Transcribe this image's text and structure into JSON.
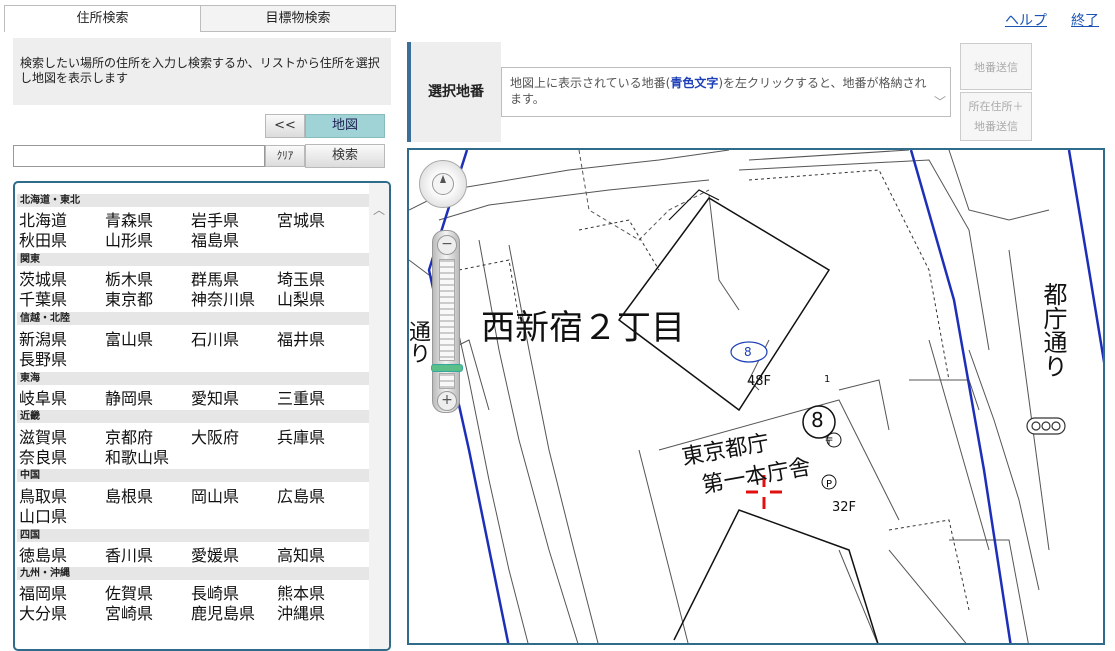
{
  "tabs": {
    "address": "住所検索",
    "landmark": "目標物検索"
  },
  "instruction": "検索したい場所の住所を入力し検索するか、リストから住所を選択し地図を表示します",
  "buttons": {
    "back": "<<",
    "map": "地図",
    "clear": "ｸﾘｱ",
    "search": "検索"
  },
  "search_input": {
    "value": "",
    "placeholder": ""
  },
  "regions": [
    {
      "name": "北海道・東北",
      "prefs": [
        "北海道",
        "青森県",
        "岩手県",
        "宮城県",
        "秋田県",
        "山形県",
        "福島県"
      ]
    },
    {
      "name": "関東",
      "prefs": [
        "茨城県",
        "栃木県",
        "群馬県",
        "埼玉県",
        "千葉県",
        "東京都",
        "神奈川県",
        "山梨県"
      ]
    },
    {
      "name": "信越・北陸",
      "prefs": [
        "新潟県",
        "富山県",
        "石川県",
        "福井県",
        "長野県"
      ]
    },
    {
      "name": "東海",
      "prefs": [
        "岐阜県",
        "静岡県",
        "愛知県",
        "三重県"
      ]
    },
    {
      "name": "近畿",
      "prefs": [
        "滋賀県",
        "京都府",
        "大阪府",
        "兵庫県",
        "奈良県",
        "和歌山県"
      ]
    },
    {
      "name": "中国",
      "prefs": [
        "鳥取県",
        "島根県",
        "岡山県",
        "広島県",
        "山口県"
      ]
    },
    {
      "name": "四国",
      "prefs": [
        "徳島県",
        "香川県",
        "愛媛県",
        "高知県"
      ]
    },
    {
      "name": "九州・沖縄",
      "prefs": [
        "福岡県",
        "佐賀県",
        "長崎県",
        "熊本県",
        "大分県",
        "宮崎県",
        "鹿児島県",
        "沖縄県"
      ]
    }
  ],
  "header": {
    "help": "ヘルプ",
    "exit": "終了"
  },
  "selection": {
    "label": "選択地番",
    "text_before": "地図上に表示されている地番(",
    "text_highlight": "青色文字",
    "text_after": ")を左クリックすると、地番が格納されます。",
    "send_lot": "地番送信",
    "send_addr_line1": "所在住所＋",
    "send_addr_line2": "地番送信"
  },
  "map": {
    "district": "西新宿２丁目",
    "lot_number": "8",
    "floors_a": "48F",
    "building_number": "8",
    "floors_b": "32F",
    "marker_small": "1",
    "building_line1": "東京都庁",
    "building_line2": "第一本庁舎",
    "street_right": "都庁通り",
    "street_left": "通り"
  },
  "colors": {
    "accent": "#2f6b8a",
    "link": "#1a55b5",
    "map_button": "#9fd3d6",
    "lot_blue": "#1d3fb8"
  }
}
